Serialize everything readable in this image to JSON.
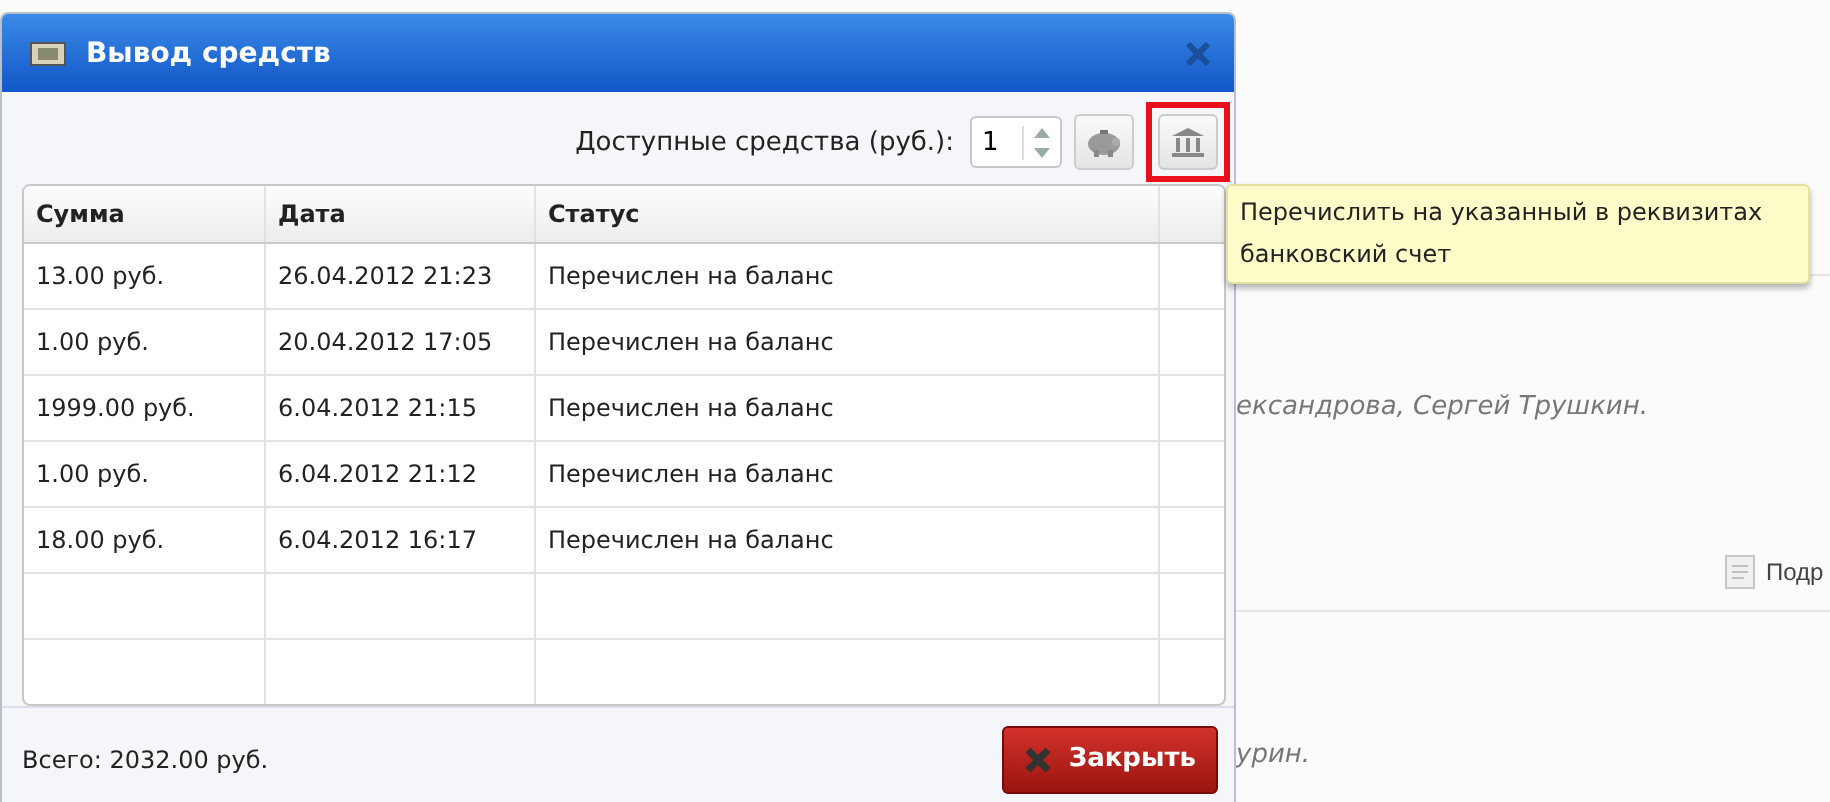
{
  "background": {
    "fragments": [
      {
        "kind": "italic",
        "text": "ександрова, Сергей Трушкин."
      },
      {
        "kind": "link",
        "text": "Подр"
      },
      {
        "kind": "italic",
        "text": "урин."
      }
    ]
  },
  "dialog": {
    "title": "Вывод средств",
    "available_label": "Доступные средства (руб.):",
    "available_value": "1",
    "table": {
      "columns": [
        "Сумма",
        "Дата",
        "Статус"
      ],
      "rows": [
        {
          "amount": "13.00 руб.",
          "date": "26.04.2012 21:23",
          "status": "Перечислен на баланс"
        },
        {
          "amount": "1.00 руб.",
          "date": "20.04.2012 17:05",
          "status": "Перечислен на баланс"
        },
        {
          "amount": "1999.00 руб.",
          "date": "6.04.2012 21:15",
          "status": "Перечислен на баланс"
        },
        {
          "amount": "1.00 руб.",
          "date": "6.04.2012 21:12",
          "status": "Перечислен на баланс"
        },
        {
          "amount": "18.00 руб.",
          "date": "6.04.2012 16:17",
          "status": "Перечислен на баланс"
        }
      ]
    },
    "total": "Всего: 2032.00 руб.",
    "close_button": "Закрыть"
  },
  "tooltip": "Перечислить на указанный в реквизитах банковский счет"
}
